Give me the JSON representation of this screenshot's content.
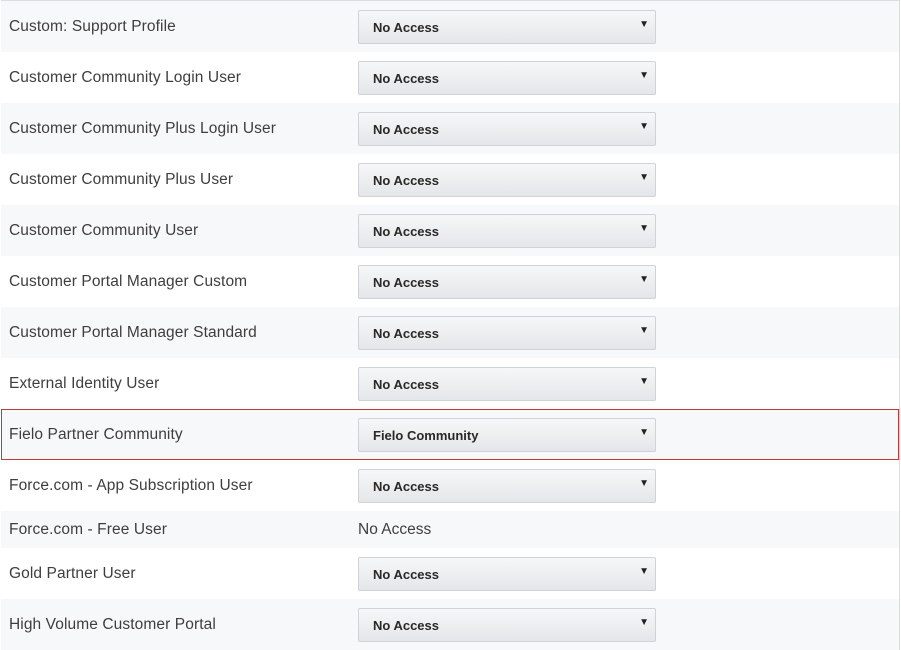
{
  "rows": [
    {
      "profile": "Custom: Support Profile",
      "value": "No Access"
    },
    {
      "profile": "Customer Community Login User",
      "value": "No Access"
    },
    {
      "profile": "Customer Community Plus Login User",
      "value": "No Access"
    },
    {
      "profile": "Customer Community Plus User",
      "value": "No Access"
    },
    {
      "profile": "Customer Community User",
      "value": "No Access"
    },
    {
      "profile": "Customer Portal Manager Custom",
      "value": "No Access"
    },
    {
      "profile": "Customer Portal Manager Standard",
      "value": "No Access"
    },
    {
      "profile": "External Identity User",
      "value": "No Access"
    },
    {
      "profile": "Fielo Partner Community",
      "value": "Fielo Community"
    },
    {
      "profile": "Force.com - App Subscription User",
      "value": "No Access"
    },
    {
      "profile": "Force.com - Free User",
      "value": "No Access"
    },
    {
      "profile": "Gold Partner User",
      "value": "No Access"
    },
    {
      "profile": "High Volume Customer Portal",
      "value": "No Access"
    }
  ],
  "dropdown_arrow": "▼",
  "highlight_color": "#c23934"
}
